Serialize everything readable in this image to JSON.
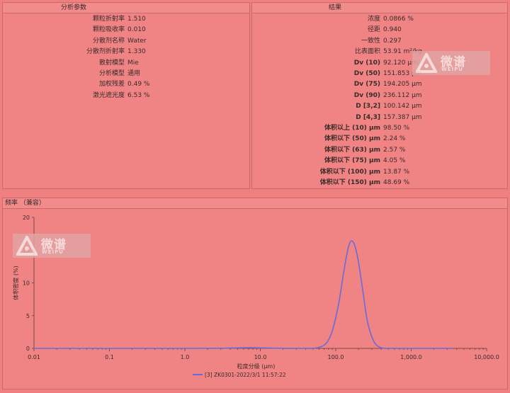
{
  "params_panel": {
    "title": "分析参数",
    "rows": [
      {
        "label": "颗粒折射率",
        "value": "1.510"
      },
      {
        "label": "颗粒吸收率",
        "value": "0.010"
      },
      {
        "label": "分散剂名称",
        "value": "Water"
      },
      {
        "label": "分散剂折射率",
        "value": "1.330"
      },
      {
        "label": "散射模型",
        "value": "Mie"
      },
      {
        "label": "分析模型",
        "value": "通用"
      },
      {
        "label": "加权残差",
        "value": "0.49 %"
      },
      {
        "label": "激光遮光度",
        "value": "6.53 %"
      }
    ]
  },
  "results_panel": {
    "title": "结果",
    "rows": [
      {
        "label": "浓度",
        "value": "0.0866 %",
        "bold": false
      },
      {
        "label": "径距",
        "value": "0.940",
        "bold": false
      },
      {
        "label": "一致性",
        "value": "0.297",
        "bold": false
      },
      {
        "label": "比表面积",
        "value": "53.91 m²/kg",
        "bold": false
      },
      {
        "label": "Dv (10)",
        "value": "92.120 μm",
        "bold": true
      },
      {
        "label": "Dv (50)",
        "value": "151.853 μm",
        "bold": true
      },
      {
        "label": "Dv (75)",
        "value": "194.205 μm",
        "bold": true
      },
      {
        "label": "Dv (90)",
        "value": "236.112 μm",
        "bold": true
      },
      {
        "label": "D [3,2]",
        "value": "100.142 μm",
        "bold": true
      },
      {
        "label": "D [4,3]",
        "value": "157.387 μm",
        "bold": true
      },
      {
        "label": "体积以上 (10) μm",
        "value": "98.50 %",
        "bold": true
      },
      {
        "label": "体积以下 (50) μm",
        "value": "2.24 %",
        "bold": true
      },
      {
        "label": "体积以下 (63) μm",
        "value": "2.57 %",
        "bold": true
      },
      {
        "label": "体积以下 (75) μm",
        "value": "4.05 %",
        "bold": true
      },
      {
        "label": "体积以下 (100) μm",
        "value": "13.87 %",
        "bold": true
      },
      {
        "label": "体积以下 (150) μm",
        "value": "48.69 %",
        "bold": true
      }
    ]
  },
  "freq_panel": {
    "title": "频率 （兼容）"
  },
  "watermark": {
    "cn": "微谱",
    "en": "WEIPU"
  },
  "chart_data": {
    "type": "line",
    "xscale": "log",
    "xlabel": "粒度分级 (μm)",
    "ylabel": "体积密度 (%)",
    "xlim": [
      0.01,
      10000
    ],
    "ylim": [
      0,
      20
    ],
    "xticks": [
      {
        "value": 0.01,
        "label": "0.01"
      },
      {
        "value": 0.1,
        "label": "0.1"
      },
      {
        "value": 1,
        "label": "1.0"
      },
      {
        "value": 10,
        "label": "10.0"
      },
      {
        "value": 100,
        "label": "100.0"
      },
      {
        "value": 1000,
        "label": "1,000.0"
      },
      {
        "value": 10000,
        "label": "10,000.0"
      }
    ],
    "yticks": [
      0,
      5,
      10,
      15,
      20
    ],
    "legend_position": "bottom-center",
    "series": [
      {
        "name": "[3] ZK0301-2022/3/1 11:57:22",
        "color": "#6a6ad8",
        "x": [
          0.01,
          0.1,
          1,
          3,
          5,
          7,
          10,
          20,
          40,
          55,
          65,
          75,
          85,
          95,
          110,
          125,
          140,
          152,
          165,
          180,
          200,
          230,
          260,
          300,
          340,
          400,
          500,
          1000,
          3500
        ],
        "y": [
          0,
          0,
          0,
          0.02,
          0.08,
          0.12,
          0.08,
          0.01,
          0,
          0.05,
          0.3,
          0.8,
          1.9,
          3.6,
          7.0,
          11.0,
          14.3,
          16.0,
          16.4,
          15.6,
          13.2,
          8.6,
          4.4,
          1.8,
          0.6,
          0.1,
          0,
          0,
          0
        ]
      }
    ]
  }
}
